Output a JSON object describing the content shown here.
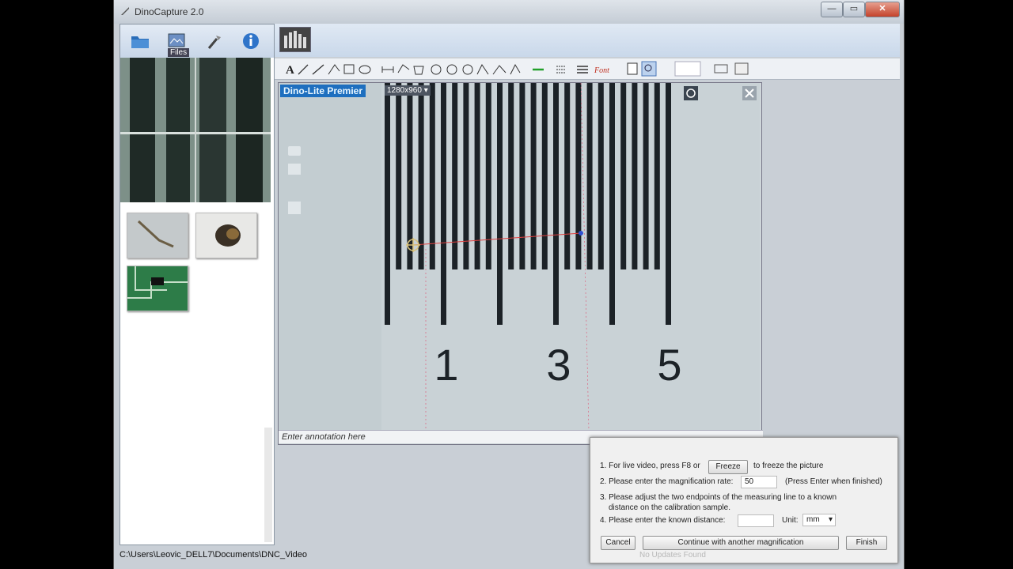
{
  "window": {
    "title": "DinoCapture 2.0",
    "controls": {
      "minimize": "—",
      "maximize": "▭",
      "close": "✕"
    }
  },
  "left_toolbar": {
    "files_label": "Files",
    "icons": [
      "folder-icon",
      "files-icon",
      "tools-icon",
      "info-icon"
    ]
  },
  "viewer": {
    "title": "Dino-Lite Premier",
    "resolution": "1280x960",
    "annotation_placeholder": "Enter annotation here",
    "scale_numbers": [
      "1",
      "3",
      "5"
    ]
  },
  "dialog": {
    "line1_pre": "1. For live video, press F8 or",
    "freeze_button": "Freeze",
    "line1_post": "to freeze the picture",
    "line2_label": "2. Please enter the magnification rate:",
    "magnification_value": "50",
    "line2_hint": "(Press Enter when finished)",
    "line3a": "3. Please adjust the two endpoints of the measuring line to a known",
    "line3b": "distance on the calibration sample.",
    "line4_label": "4. Please enter the known distance:",
    "distance_value": "",
    "unit_label": "Unit:",
    "unit_value": "mm",
    "cancel_button": "Cancel",
    "continue_button": "Continue with another magnification",
    "finish_button": "Finish",
    "hidden_status": "No Updates Found"
  },
  "statusbar": {
    "path": "C:\\Users\\Leovic_DELL7\\Documents\\DNC_Video"
  }
}
